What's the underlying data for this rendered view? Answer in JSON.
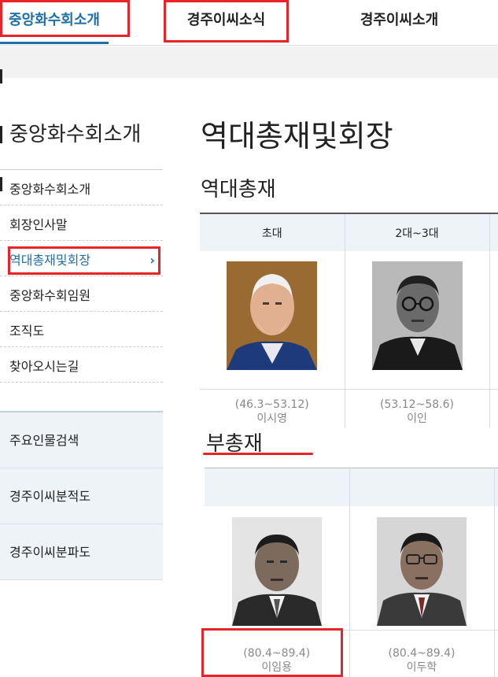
{
  "top_nav": {
    "tabs": [
      {
        "label": "중앙화수회소개"
      },
      {
        "label": "경주이씨소식"
      },
      {
        "label": "경주이씨소개"
      }
    ]
  },
  "sidebar": {
    "title": "중앙화수회소개",
    "items": [
      {
        "label": "중앙화수회소개"
      },
      {
        "label": "회장인사말"
      },
      {
        "label": "역대총재및회장",
        "arrow": "›"
      },
      {
        "label": "중앙화수회임원"
      },
      {
        "label": "조직도"
      },
      {
        "label": "찾아오시는길"
      }
    ],
    "sub_items": [
      {
        "label": "주요인물검색"
      },
      {
        "label": "경주이씨분적도"
      },
      {
        "label": "경주이씨분파도"
      }
    ]
  },
  "main": {
    "page_title": "역대총재및회장",
    "presidents": {
      "title": "역대총재",
      "columns": [
        "초대",
        "2대~3대"
      ],
      "entries": [
        {
          "period": "(46.3~53.12)",
          "name": "이시영"
        },
        {
          "period": "(53.12~58.6)",
          "name": "이인"
        }
      ]
    },
    "vice_presidents": {
      "title": "부총재",
      "columns": [
        "",
        ""
      ],
      "entries": [
        {
          "period": "(80.4~89.4)",
          "name": "이임용"
        },
        {
          "period": "(80.4~89.4)",
          "name": "이두학"
        }
      ]
    }
  },
  "colors": {
    "accent": "#1f6fa9",
    "highlight": "#e8232a",
    "header_bg": "#eef3f7"
  }
}
